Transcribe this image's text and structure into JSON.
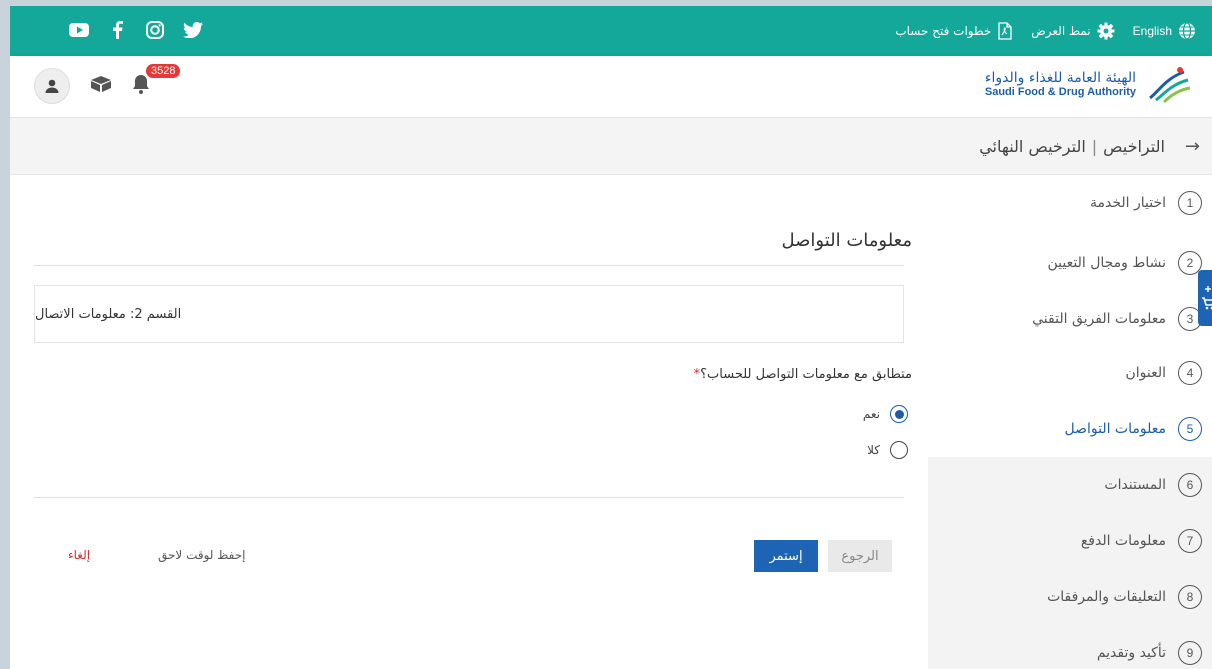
{
  "topbar": {
    "language_label": "English",
    "display_mode_label": "نمط العرض",
    "account_steps_label": "خطوات فتح حساب",
    "social": [
      "youtube-icon",
      "facebook-icon",
      "instagram-icon",
      "twitter-icon"
    ]
  },
  "header": {
    "logo_ar": "الهيئة العامة للغذاء والدواء",
    "logo_en": "Saudi Food & Drug Authority",
    "notification_count": "3528"
  },
  "breadcrumb": {
    "root": "التراخيص",
    "separator": "|",
    "current": "الترخيص النهائي"
  },
  "sidebar": {
    "steps": [
      {
        "num": "1",
        "label": "اختيار الخدمة"
      },
      {
        "num": "2",
        "label": "نشاط ومجال التعيين"
      },
      {
        "num": "3",
        "label": "معلومات الفريق التقني"
      },
      {
        "num": "4",
        "label": "العنوان"
      },
      {
        "num": "5",
        "label": "معلومات التواصل"
      },
      {
        "num": "6",
        "label": "المستندات"
      },
      {
        "num": "7",
        "label": "معلومات الدفع"
      },
      {
        "num": "8",
        "label": "التعليقات والمرفقات"
      },
      {
        "num": "9",
        "label": "تأكيد وتقديم"
      }
    ]
  },
  "main": {
    "title": "معلومات التواصل",
    "section_label": "القسم 2: معلومات الاتصال",
    "question": "متطابق مع معلومات التواصل للحساب؟",
    "required_mark": "*",
    "options": [
      {
        "label": "نعم",
        "selected": true
      },
      {
        "label": "كلا",
        "selected": false
      }
    ],
    "continue_label": "إستمر",
    "back_label": "الرجوع",
    "save_later_label": "إحفظ لوقت لاحق",
    "cancel_label": "إلغاء"
  },
  "colors": {
    "teal": "#14a89a",
    "blue": "#1e64b4",
    "red": "#d32f2f"
  }
}
